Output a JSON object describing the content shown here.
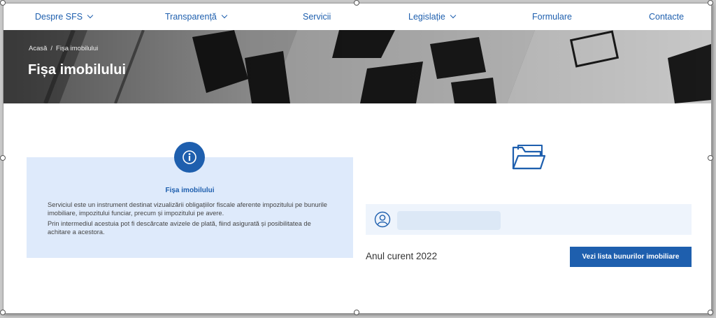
{
  "nav": {
    "items": [
      {
        "label": "Despre SFS",
        "has_dropdown": true
      },
      {
        "label": "Transparență",
        "has_dropdown": true
      },
      {
        "label": "Servicii",
        "has_dropdown": false
      },
      {
        "label": "Legislație",
        "has_dropdown": true
      },
      {
        "label": "Formulare",
        "has_dropdown": false
      },
      {
        "label": "Contacte",
        "has_dropdown": false
      }
    ]
  },
  "breadcrumb": {
    "home": "Acasă",
    "separator": "/",
    "current": "Fișa imobilului"
  },
  "hero": {
    "title": "Fișa imobilului"
  },
  "info_card": {
    "title": "Fișa imobilului",
    "paragraphs": [
      "Serviciul este un instrument destinat vizualizării obligațiilor fiscale aferente impozitului pe bunurile imobiliare, impozitului funciar, precum și impozitului pe avere.",
      "Prin intermediul acestuia pot fi descărcate avizele de plată, fiind asigurată și posibilitatea de achitare a acestora."
    ]
  },
  "user_panel": {
    "input_value": ""
  },
  "year": {
    "text": "Anul curent 2022"
  },
  "actions": {
    "list_button": "Vezi lista bunurilor imobiliare"
  },
  "colors": {
    "primary": "#1e5fae",
    "card_bg": "#deeafb",
    "panel_bg": "#eef4fc"
  },
  "icons": {
    "info": "info-icon",
    "folder": "folder-open-icon",
    "user": "user-icon",
    "chevron": "chevron-down-icon"
  }
}
